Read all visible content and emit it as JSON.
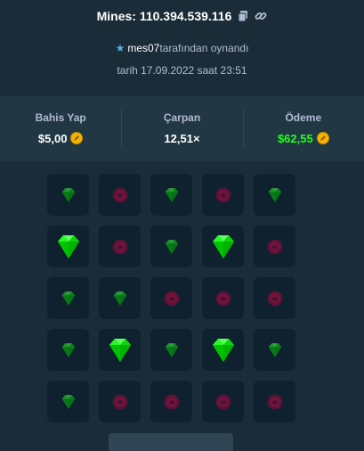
{
  "header": {
    "title": "Mines: 110.394.539.116",
    "copy_icon": "copy-icon",
    "link_icon": "link-icon"
  },
  "player": {
    "name": "mes07",
    "suffix": "tarafından oynandı",
    "icon": "star-icon"
  },
  "date_text": "tarih 17.09.2022 saat 23:51",
  "stats": {
    "bet_label": "Bahis Yap",
    "bet_value": "$5,00",
    "multiplier_label": "Çarpan",
    "multiplier_value": "12,51×",
    "payout_label": "Ödeme",
    "payout_value": "$62,55"
  },
  "grid": [
    [
      "gem",
      "mine",
      "gem",
      "mine",
      "gem"
    ],
    [
      "gem-revealed",
      "mine",
      "gem",
      "gem-revealed",
      "mine"
    ],
    [
      "gem",
      "gem",
      "mine",
      "mine",
      "mine"
    ],
    [
      "gem",
      "gem-revealed",
      "gem",
      "gem-revealed",
      "gem"
    ],
    [
      "gem",
      "mine",
      "mine",
      "mine",
      "mine"
    ]
  ],
  "colors": {
    "background": "#1a2c38",
    "panel": "#213743",
    "tile": "#0f212e",
    "gem": "#00e701",
    "mine": "#a3063e",
    "payout": "#1fff20"
  }
}
